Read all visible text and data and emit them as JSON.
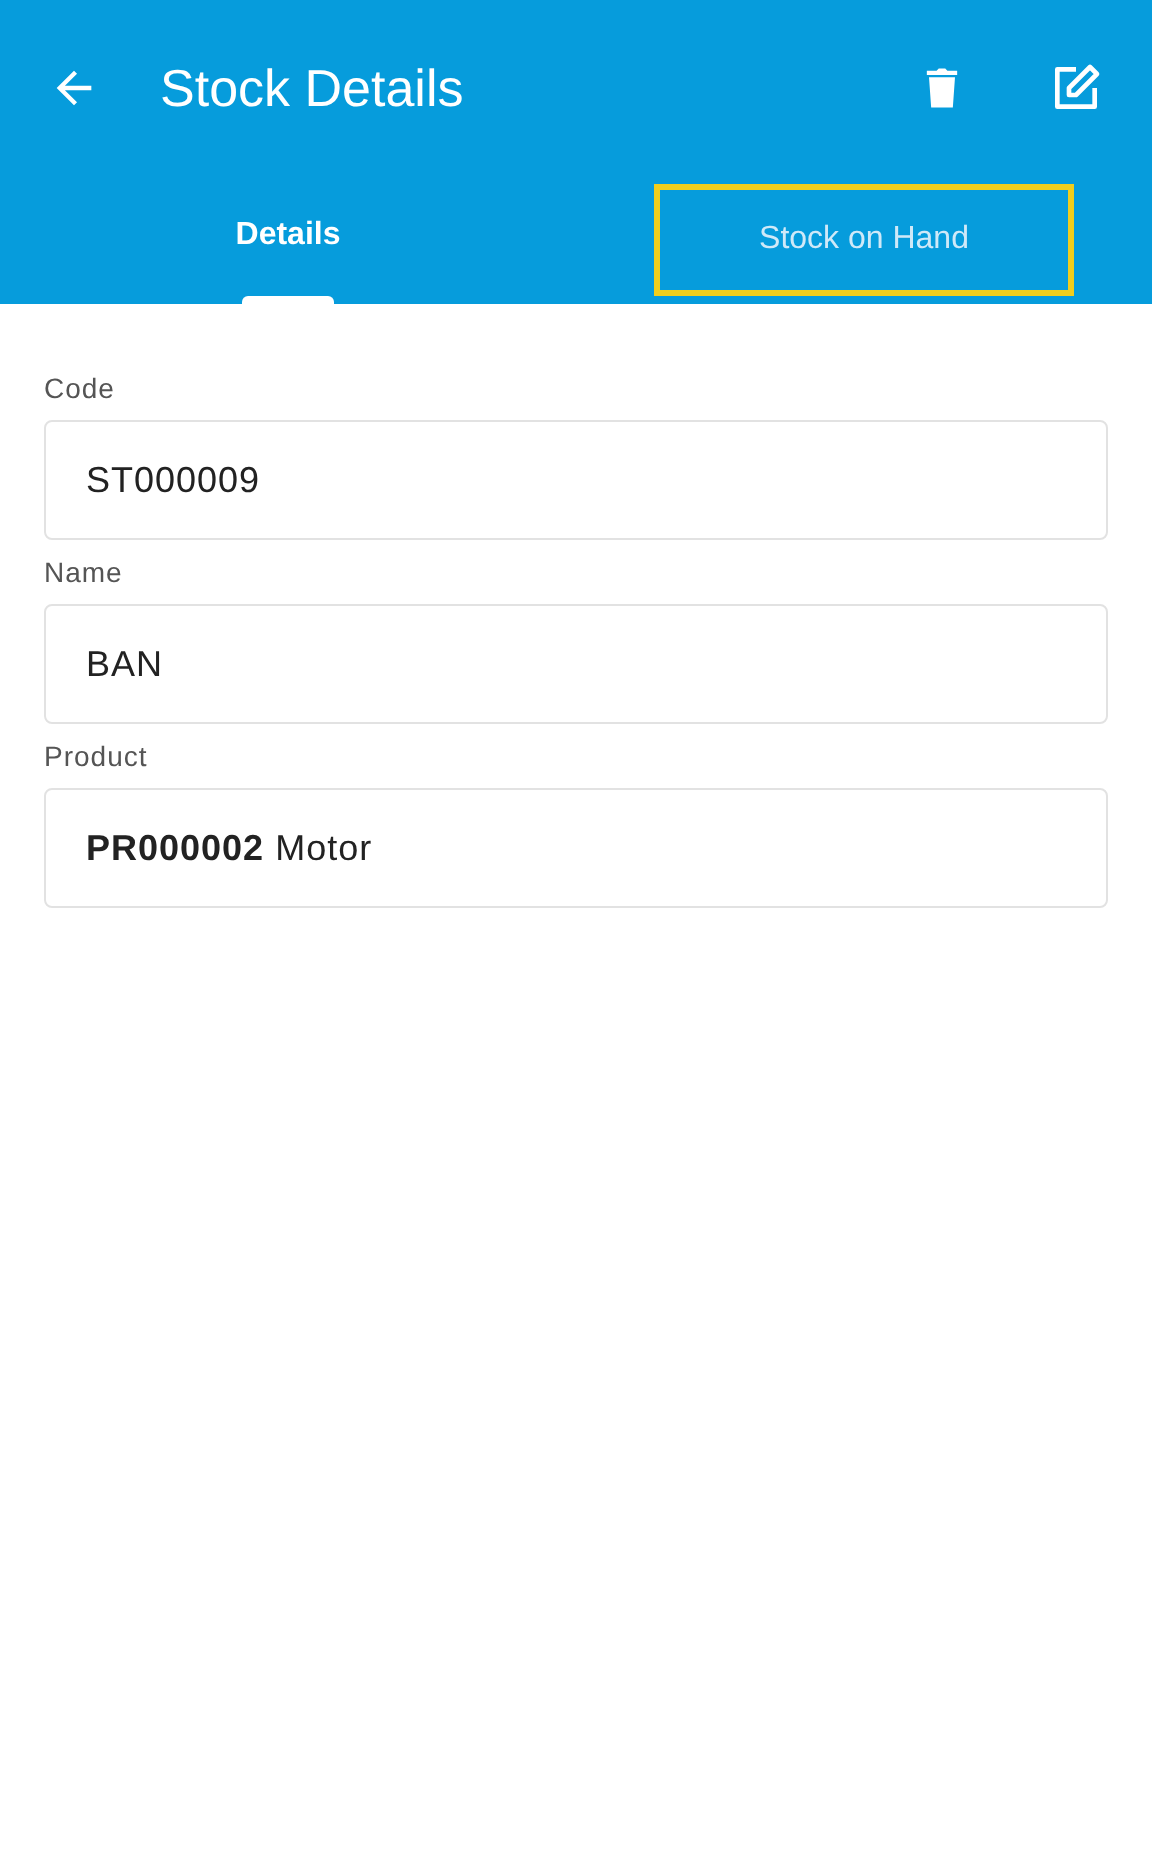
{
  "app_bar": {
    "title": "Stock Details"
  },
  "tabs": [
    {
      "label": "Details",
      "selected": true,
      "highlighted": false
    },
    {
      "label": "Stock on Hand",
      "selected": false,
      "highlighted": true
    }
  ],
  "fields": [
    {
      "label": "Code",
      "value": "ST000009"
    },
    {
      "label": "Name",
      "value": "BAN"
    },
    {
      "label": "Product",
      "value": "**PR000002** Motor"
    }
  ]
}
